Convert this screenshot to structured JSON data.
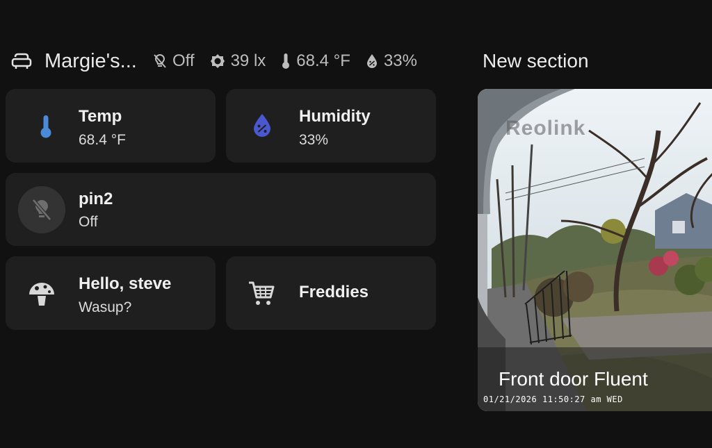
{
  "area": {
    "title": "Margie's...",
    "icon": "sofa-icon",
    "badges": [
      {
        "icon": "lightbulb-off-icon",
        "value": "Off"
      },
      {
        "icon": "brightness-icon",
        "value": "39 lx"
      },
      {
        "icon": "thermometer-icon",
        "value": "68.4 °F"
      },
      {
        "icon": "water-percent-icon",
        "value": "33%"
      }
    ]
  },
  "section": {
    "title": "New section"
  },
  "tiles": {
    "temp": {
      "name": "Temp",
      "state": "68.4 °F",
      "icon": "thermometer-icon",
      "color": "#4a8ad6"
    },
    "humidity": {
      "name": "Humidity",
      "state": "33%",
      "icon": "water-percent-icon",
      "color": "#4a58d0"
    },
    "pin2": {
      "name": "pin2",
      "state": "Off",
      "icon": "lightbulb-off-icon"
    },
    "hello": {
      "name": "Hello, steve",
      "state": "Wasup?",
      "icon": "mushroom-icon"
    },
    "freddies": {
      "name": "Freddies",
      "icon": "cart-icon"
    }
  },
  "camera": {
    "name": "Front door Fluent",
    "watermark": "Reolink",
    "timestamp": "01/21/2026 11:50:27 am WED"
  }
}
